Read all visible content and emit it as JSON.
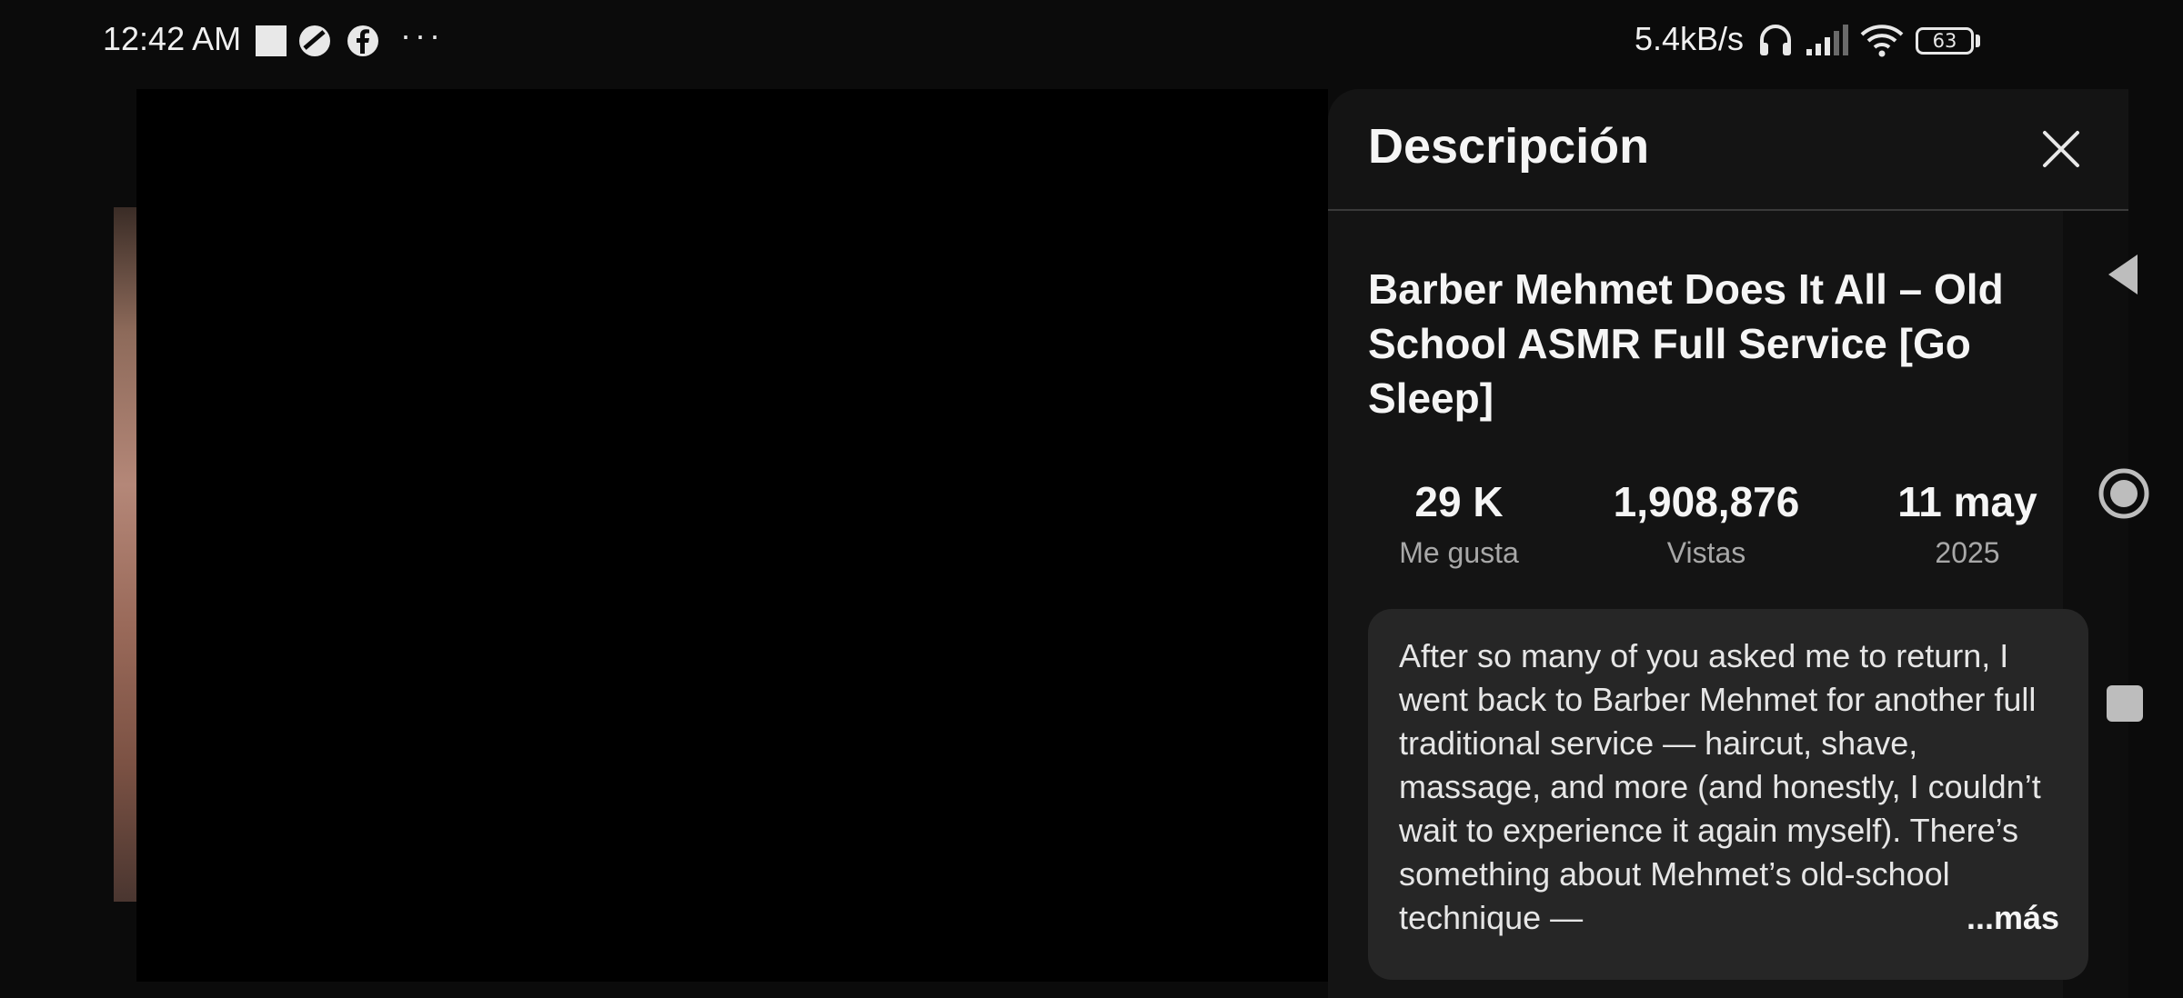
{
  "status_bar": {
    "time": "12:42 AM",
    "dots": "···",
    "net_speed": "5.4kB/s",
    "battery": "63",
    "icons": [
      "notification-square-icon",
      "vpn-icon",
      "facebook-icon",
      "headphones-icon",
      "signal-icon",
      "wifi-icon",
      "battery-icon"
    ]
  },
  "panel": {
    "title": "Descripción",
    "video_title": "Barber Mehmet Does It All – Old School ASMR Full Service [Go Sleep]",
    "stats": [
      {
        "value": "29 K",
        "label": "Me gusta"
      },
      {
        "value": "1,908,876",
        "label": "Vistas"
      },
      {
        "value": "11 may",
        "label": "2025"
      }
    ],
    "description": "After so many of you asked me to return, I went back to Barber Mehmet for another full traditional service — haircut, shave, massage, and more (and honestly, I couldn’t wait to experience it again myself). There’s something about Mehmet’s old-school technique — ",
    "more_label": "...más"
  },
  "colors": {
    "background": "#0b0b0b",
    "panel": "#141414",
    "description_box": "#262626",
    "secondary_text": "#a8a8a8"
  },
  "nav": [
    "back-icon",
    "home-icon",
    "recents-icon"
  ]
}
